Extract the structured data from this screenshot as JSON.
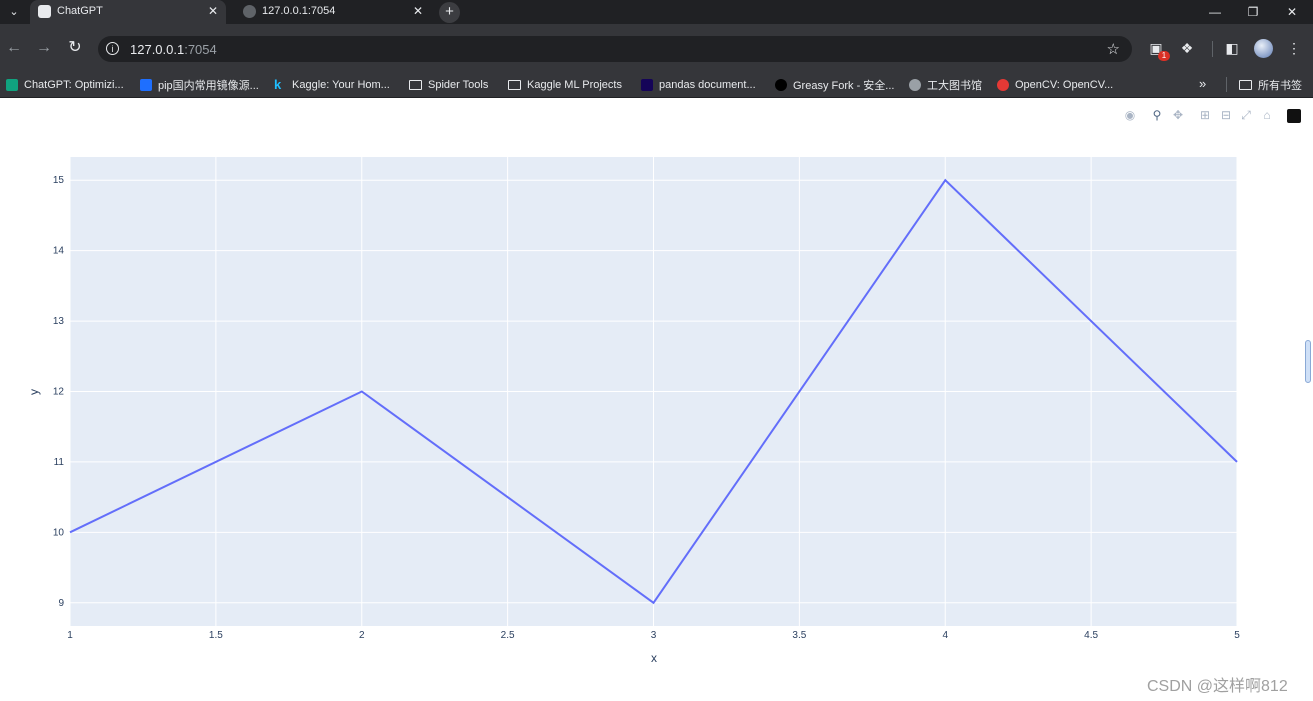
{
  "browser": {
    "tabs": [
      {
        "title": "ChatGPT",
        "active": true
      },
      {
        "title": "127.0.0.1:7054",
        "active": false
      }
    ],
    "url_host": "127.0.0.1",
    "url_port": ":7054",
    "extension_badge": "1",
    "bookmarks": [
      {
        "label": "ChatGPT: Optimizi...",
        "icon": "chatgpt-icon",
        "color": "#10a37f"
      },
      {
        "label": "pip国内常用镜像源...",
        "icon": "zhihu-icon",
        "color": "#1e6fff"
      },
      {
        "label": "Kaggle: Your Hom...",
        "icon": "kaggle-icon",
        "color": "#20beff"
      },
      {
        "label": "Spider Tools",
        "icon": "folder-icon"
      },
      {
        "label": "Kaggle ML Projects",
        "icon": "folder-icon"
      },
      {
        "label": "pandas document...",
        "icon": "pandas-icon",
        "color": "#150458"
      },
      {
        "label": "Greasy Fork - 安全...",
        "icon": "greasyfork-icon",
        "color": "#000000"
      },
      {
        "label": "工大图书馆",
        "icon": "globe-icon",
        "color": "#9aa0a6"
      },
      {
        "label": "OpenCV: OpenCV...",
        "icon": "opencv-icon",
        "color": "#e53935"
      }
    ],
    "all_bookmarks_label": "所有书签"
  },
  "watermark": "CSDN @这样啊812",
  "chart_data": {
    "type": "line",
    "x": [
      1,
      2,
      3,
      4,
      5
    ],
    "series": [
      {
        "values": [
          10,
          12,
          9,
          15,
          11
        ],
        "color": "#636efa"
      }
    ],
    "xlabel": "x",
    "ylabel": "y",
    "xticks": [
      "1",
      "1.5",
      "2",
      "2.5",
      "3",
      "3.5",
      "4",
      "4.5",
      "5"
    ],
    "yticks": [
      "9",
      "10",
      "11",
      "12",
      "13",
      "14",
      "15"
    ],
    "xlim": [
      1,
      5
    ],
    "ylim": [
      8.67,
      15.33
    ],
    "grid": true,
    "plot_bg": "#e5ecf6"
  }
}
